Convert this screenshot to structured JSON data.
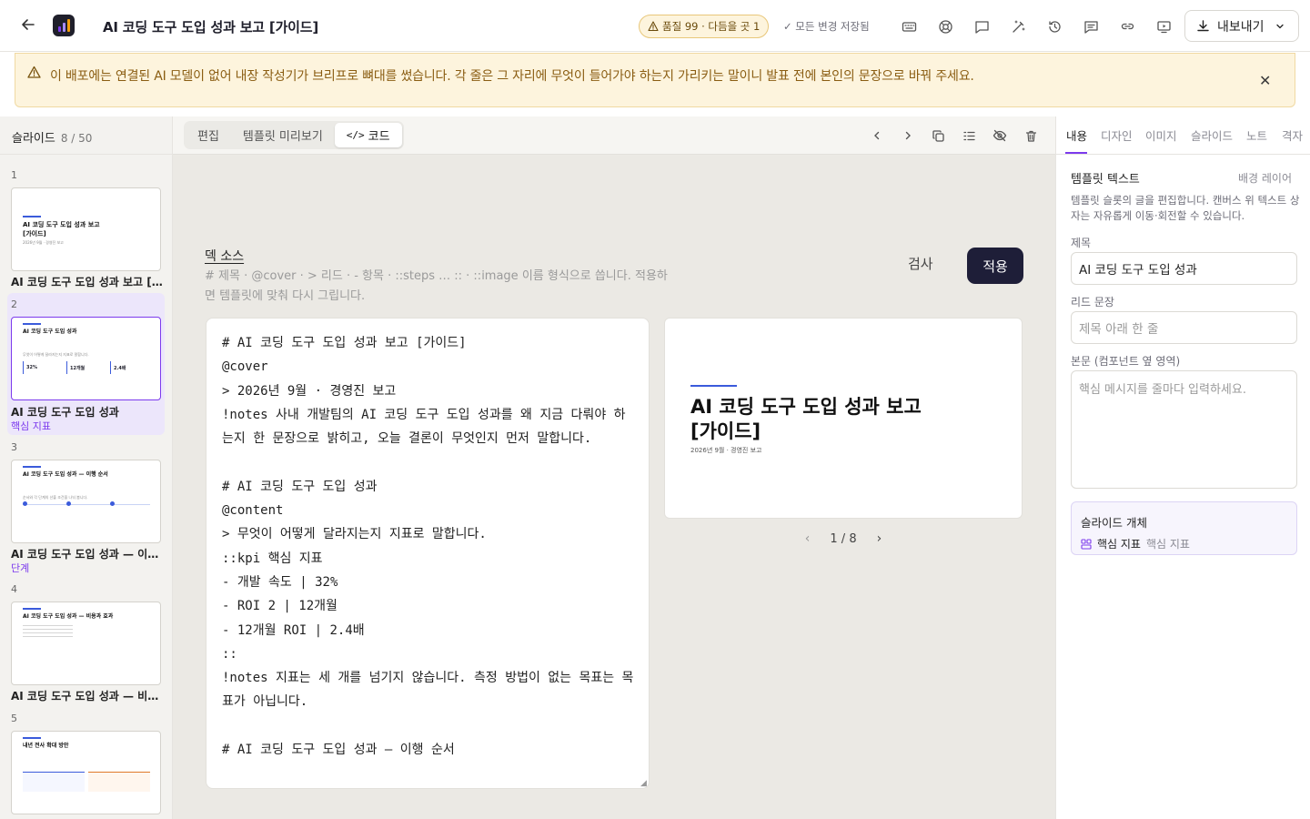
{
  "header": {
    "title": "AI 코딩 도구 도입 성과 보고 [가이드]",
    "quality_badge": "품질 99 · 다듬을 곳 1",
    "saved_status": "모든 변경 저장됨",
    "export_label": "내보내기",
    "tools": [
      "keyboard-icon",
      "help-icon",
      "comment-icon",
      "magic-wand-icon",
      "history-icon",
      "notes-icon",
      "link-icon",
      "present-icon"
    ]
  },
  "banner": {
    "text": "이 배포에는 연결된 AI 모델이 없어 내장 작성기가 브리프로 뼈대를 썼습니다. 각 줄은 그 자리에 무엇이 들어가야 하는지 가리키는 말이니 발표 전에 본인의 문장으로 바꿔 주세요."
  },
  "sidebar": {
    "label": "슬라이드",
    "count": "8 / 50",
    "slides": [
      {
        "num": "1",
        "label": "AI 코딩 도구 도입 성과 보고 [가이드]",
        "sub": "",
        "thumb_title": "AI 코딩 도구 도입 성과 보고\n[가이드]",
        "thumb_sub": "2026년 9월 · 경영진 보고"
      },
      {
        "num": "2",
        "label": "AI 코딩 도구 도입 성과",
        "sub": "핵심 지표",
        "thumb_title": "AI 코딩 도구 도입 성과",
        "thumb_sub": "무엇이 어떻게 달라지는지 지표로 말합니다.",
        "kpis": [
          "32%",
          "12개월",
          "2.4배"
        ]
      },
      {
        "num": "3",
        "label": "AI 코딩 도구 도입 성과 — 이행 순서",
        "sub": "단계",
        "thumb_title": "AI 코딩 도구 도입 성과 — 이행 순서",
        "thumb_sub": "순서와 각 단계의 산출 조건을 나눠 봅니다."
      },
      {
        "num": "4",
        "label": "AI 코딩 도구 도입 성과 — 비용과 효과",
        "sub": "",
        "thumb_title": "AI 코딩 도구 도입 성과 — 비용과 효과",
        "thumb_sub": ""
      },
      {
        "num": "5",
        "label": "내년 전사 확대 방안",
        "sub": "",
        "thumb_title": "내년 전사 확대 방안",
        "thumb_sub": ""
      }
    ]
  },
  "toolbar": {
    "tabs": [
      "편집",
      "템플릿 미리보기",
      "코드"
    ],
    "active_tab": "코드"
  },
  "source": {
    "title": "덱 소스",
    "hint": "# 제목 · @cover · > 리드 · - 항목 · ::steps … :: · ::image 이름 형식으로 씁니다. 적용하면 템플릿에 맞춰 다시 그립니다.",
    "check_label": "검사",
    "apply_label": "적용",
    "code": "# AI 코딩 도구 도입 성과 보고 [가이드]\n@cover\n> 2026년 9월 · 경영진 보고\n!notes 사내 개발팀의 AI 코딩 도구 도입 성과를 왜 지금 다뤄야 하는지 한 문장으로 밝히고, 오늘 결론이 무엇인지 먼저 말합니다.\n\n# AI 코딩 도구 도입 성과\n@content\n> 무엇이 어떻게 달라지는지 지표로 말합니다.\n::kpi 핵심 지표\n- 개발 속도 | 32%\n- ROI 2 | 12개월\n- 12개월 ROI | 2.4배\n::\n!notes 지표는 세 개를 넘기지 않습니다. 측정 방법이 없는 목표는 목표가 아닙니다.\n\n# AI 코딩 도구 도입 성과 — 이행 순서"
  },
  "preview": {
    "title": "AI 코딩 도구 도입 성과 보고\n[가이드]",
    "subtitle": "2026년 9월 · 경영진 보고",
    "page": "1 / 8"
  },
  "panel": {
    "tabs": [
      "내용",
      "디자인",
      "이미지",
      "슬라이드",
      "노트",
      "격자"
    ],
    "active_tab": "내용",
    "heading": "템플릿 텍스트",
    "bg_layer": "배경 레이어",
    "desc": "템플릿 슬롯의 글을 편집합니다. 캔버스 위 텍스트 상자는 자유롭게 이동·회전할 수 있습니다.",
    "title_label": "제목",
    "title_value": "AI 코딩 도구 도입 성과",
    "lead_label": "리드 문장",
    "lead_placeholder": "제목 아래 한 줄",
    "body_label": "본문 (컴포넌트 옆 영역)",
    "body_placeholder": "핵심 메시지를 줄마다 입력하세요.",
    "objects_label": "슬라이드 개체",
    "object_name": "핵심 지표",
    "object_type": "핵심 지표"
  }
}
